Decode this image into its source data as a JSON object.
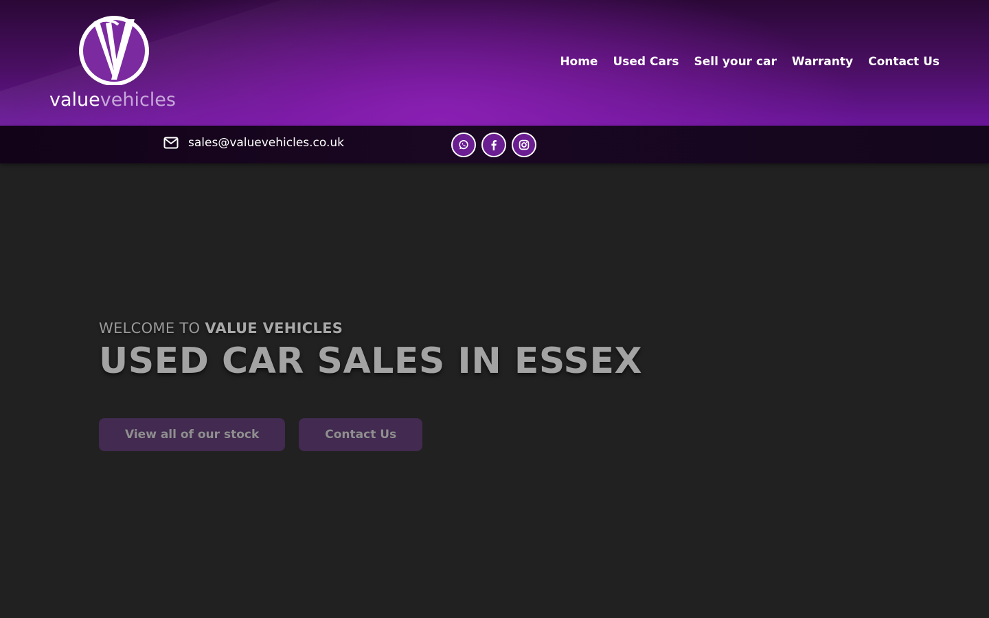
{
  "header": {
    "logo": {
      "word1": "value",
      "word2": "vehicles"
    },
    "nav": [
      {
        "label": "Home"
      },
      {
        "label": "Used Cars"
      },
      {
        "label": "Sell your car"
      },
      {
        "label": "Warranty"
      },
      {
        "label": "Contact Us"
      }
    ]
  },
  "infobar": {
    "email": "sales@valuevehicles.co.uk",
    "email_icon": "envelope-icon",
    "socials": [
      {
        "icon": "whatsapp-icon"
      },
      {
        "icon": "facebook-icon"
      },
      {
        "icon": "instagram-icon"
      }
    ]
  },
  "hero": {
    "welcome_prefix": "WELCOME TO",
    "welcome_brand": "VALUE VEHICLES",
    "headline": "USED CAR SALES IN ESSEX",
    "buttons": [
      {
        "label": "View all of our stock"
      },
      {
        "label": "Contact Us"
      }
    ]
  },
  "colors": {
    "brand_purple": "#7a1fa8",
    "header_dark": "#2a0836",
    "page_background": "#212121",
    "button_background": "#422a50"
  }
}
